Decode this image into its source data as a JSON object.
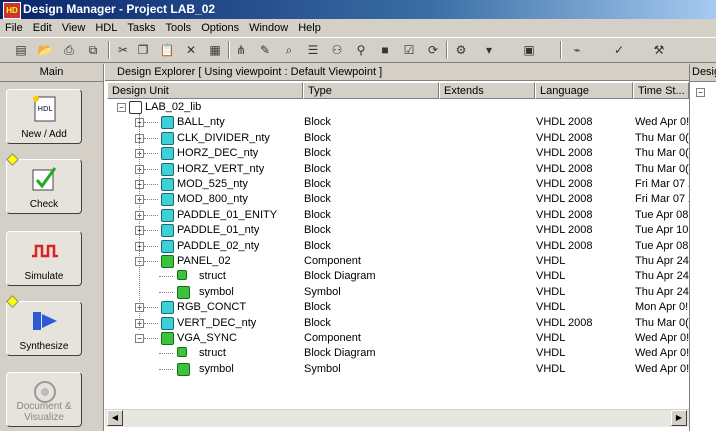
{
  "window": {
    "title": "Design Manager - Project LAB_02",
    "logo_text": "HD"
  },
  "menu": [
    "File",
    "Edit",
    "View",
    "HDL",
    "Tasks",
    "Tools",
    "Options",
    "Window",
    "Help"
  ],
  "toolbar": {
    "icons": [
      "new-icon",
      "open-icon",
      "print-icon",
      "copy-view-icon",
      "cut-icon",
      "copy-icon",
      "paste-icon",
      "delete-icon",
      "properties-icon",
      "hierarchy-icon",
      "edit-icon",
      "browse-icon",
      "list-icon",
      "tree-icon",
      "find-icon",
      "component-icon",
      "checkin-icon",
      "refresh-icon",
      "compile-icon",
      "dropdown-icon",
      "generate-icon",
      "simulate-icon",
      "wizard-icon",
      "settings-icon"
    ]
  },
  "left_pane": {
    "header": "Main",
    "buttons": [
      {
        "label": "New / Add",
        "icon": "hdl-document-icon",
        "enabled": true
      },
      {
        "label": "Check",
        "icon": "checkmark-icon",
        "enabled": true
      },
      {
        "label": "Simulate",
        "icon": "waveform-icon",
        "enabled": true
      },
      {
        "label": "Synthesize",
        "icon": "synthesis-icon",
        "enabled": true
      },
      {
        "label": "Document & Visualize",
        "icon": "document-visualize-icon",
        "enabled": false
      }
    ]
  },
  "explorer": {
    "header": "Design Explorer [ Using viewpoint :  Default Viewpoint ]",
    "columns": [
      "Design Unit",
      "Type",
      "Extends",
      "Language",
      "Time St..."
    ],
    "library": "LAB_02_lib",
    "rows": [
      {
        "name": "BALL_nty",
        "type": "Block",
        "extends": "",
        "language": "VHDL 2008",
        "time": "Wed Apr 0!",
        "level": 1,
        "kind": "block",
        "expander": "+"
      },
      {
        "name": "CLK_DIVIDER_nty",
        "type": "Block",
        "extends": "",
        "language": "VHDL 2008",
        "time": "Thu Mar 0(",
        "level": 1,
        "kind": "block",
        "expander": "+"
      },
      {
        "name": "HORZ_DEC_nty",
        "type": "Block",
        "extends": "",
        "language": "VHDL 2008",
        "time": "Thu Mar 0(",
        "level": 1,
        "kind": "block",
        "expander": "+"
      },
      {
        "name": "HORZ_VERT_nty",
        "type": "Block",
        "extends": "",
        "language": "VHDL 2008",
        "time": "Thu Mar 0(",
        "level": 1,
        "kind": "block",
        "expander": "+"
      },
      {
        "name": "MOD_525_nty",
        "type": "Block",
        "extends": "",
        "language": "VHDL 2008",
        "time": "Fri Mar 07 2",
        "level": 1,
        "kind": "block",
        "expander": "+"
      },
      {
        "name": "MOD_800_nty",
        "type": "Block",
        "extends": "",
        "language": "VHDL 2008",
        "time": "Fri Mar 07 2",
        "level": 1,
        "kind": "block",
        "expander": "+"
      },
      {
        "name": "PADDLE_01_ENITY",
        "type": "Block",
        "extends": "",
        "language": "VHDL 2008",
        "time": "Tue Apr 08",
        "level": 1,
        "kind": "block",
        "expander": "+"
      },
      {
        "name": "PADDLE_01_nty",
        "type": "Block",
        "extends": "",
        "language": "VHDL 2008",
        "time": "Tue Apr 10",
        "level": 1,
        "kind": "block",
        "expander": "+"
      },
      {
        "name": "PADDLE_02_nty",
        "type": "Block",
        "extends": "",
        "language": "VHDL 2008",
        "time": "Tue Apr 08",
        "level": 1,
        "kind": "block",
        "expander": "+"
      },
      {
        "name": "PANEL_02",
        "type": "Component",
        "extends": "",
        "language": "VHDL",
        "time": "Thu Apr 24",
        "level": 1,
        "kind": "component",
        "expander": "−"
      },
      {
        "name": "struct",
        "type": "Block Diagram",
        "extends": "",
        "language": "VHDL",
        "time": "Thu Apr 24",
        "level": 2,
        "kind": "struct",
        "expander": ""
      },
      {
        "name": "symbol",
        "type": "Symbol",
        "extends": "",
        "language": "VHDL",
        "time": "Thu Apr 24",
        "level": 2,
        "kind": "symbol",
        "expander": ""
      },
      {
        "name": "RGB_CONCT",
        "type": "Block",
        "extends": "",
        "language": "VHDL",
        "time": "Mon Apr 0!",
        "level": 1,
        "kind": "block",
        "expander": "+"
      },
      {
        "name": "VERT_DEC_nty",
        "type": "Block",
        "extends": "",
        "language": "VHDL 2008",
        "time": "Thu Mar 0(",
        "level": 1,
        "kind": "block",
        "expander": "+"
      },
      {
        "name": "VGA_SYNC",
        "type": "Component",
        "extends": "",
        "language": "VHDL",
        "time": "Wed Apr 0!",
        "level": 1,
        "kind": "component",
        "expander": "−"
      },
      {
        "name": "struct",
        "type": "Block Diagram",
        "extends": "",
        "language": "VHDL",
        "time": "Wed Apr 0!",
        "level": 2,
        "kind": "struct",
        "expander": ""
      },
      {
        "name": "symbol",
        "type": "Symbol",
        "extends": "",
        "language": "VHDL",
        "time": "Wed Apr 0!",
        "level": 2,
        "kind": "symbol",
        "expander": ""
      }
    ]
  },
  "right_pane": {
    "header": "Desig"
  }
}
